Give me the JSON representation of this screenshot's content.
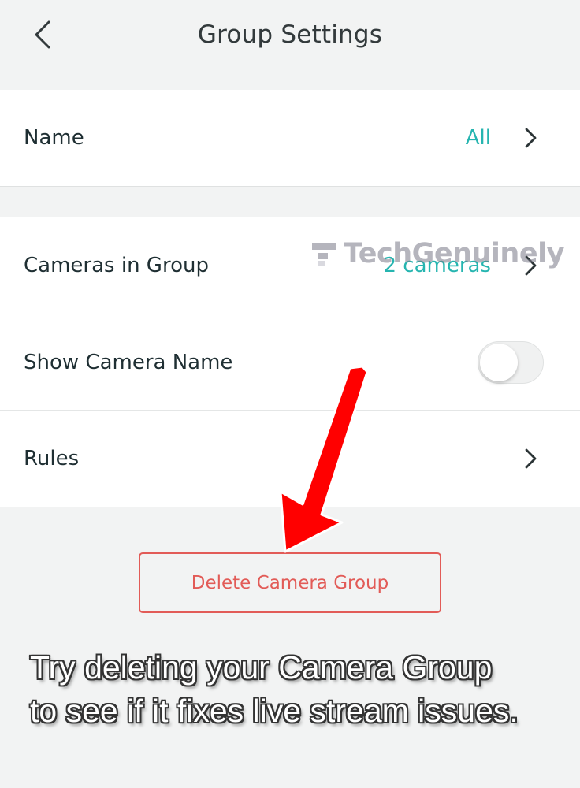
{
  "header": {
    "title": "Group Settings",
    "back_icon": "chevron-left-icon"
  },
  "group_name": {
    "label": "Name",
    "value": "All"
  },
  "group_details": {
    "cameras": {
      "label": "Cameras in Group",
      "value": "2 cameras"
    },
    "show_name": {
      "label": "Show Camera Name",
      "toggle_on": false
    },
    "rules": {
      "label": "Rules"
    }
  },
  "delete_button": {
    "label": "Delete Camera Group"
  },
  "watermark": {
    "text": "TechGenuinely"
  },
  "caption": {
    "line1": "Try deleting your Camera Group",
    "line2": "to see if it fixes live stream issues."
  },
  "colors": {
    "accent": "#26b5b0",
    "danger": "#e25b57",
    "annotation_arrow": "#ff0000",
    "background": "#f2f3f3",
    "text": "#1f2f33"
  }
}
